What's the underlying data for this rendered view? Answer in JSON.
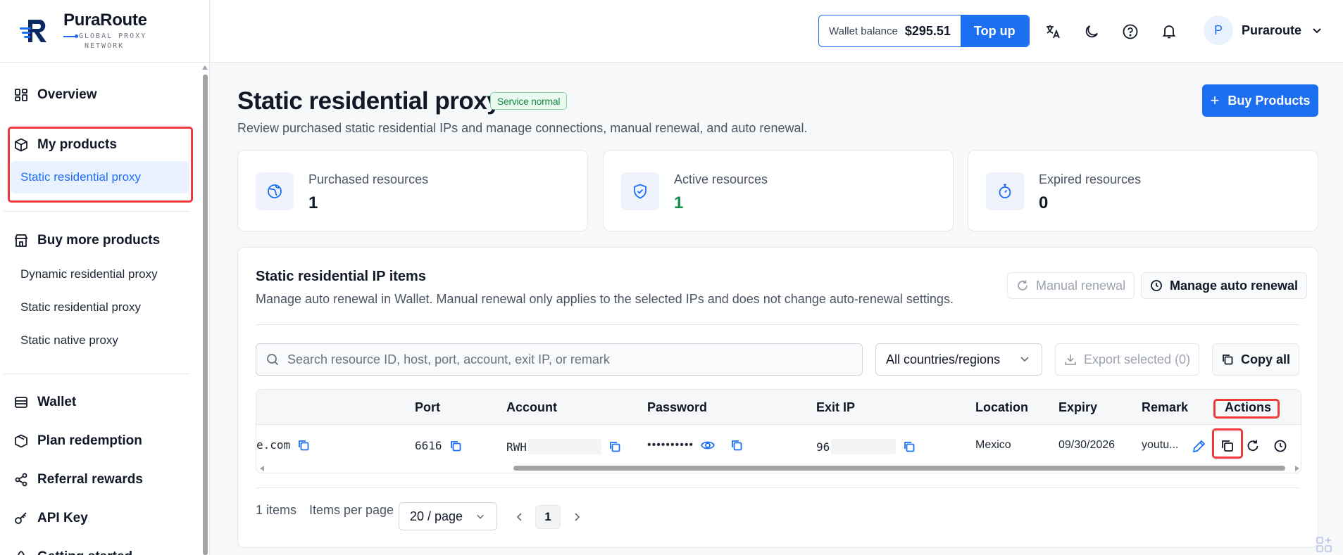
{
  "brand": {
    "name": "PuraRoute",
    "tagline_1": "GLOBAL PROXY",
    "tagline_2": "NETWORK"
  },
  "sidebar": {
    "overview": "Overview",
    "my_products": "My products",
    "my_products_sub": "Static residential proxy",
    "buy_more": "Buy more products",
    "buy_more_items": [
      "Dynamic residential proxy",
      "Static residential proxy",
      "Static native proxy"
    ],
    "wallet": "Wallet",
    "plan_redemption": "Plan redemption",
    "referral": "Referral rewards",
    "api_key": "API Key",
    "getting_started": "Getting started"
  },
  "topbar": {
    "wallet_label": "Wallet balance",
    "wallet_amount": "$295.51",
    "top_up": "Top up",
    "user_initial": "P",
    "user_name": "Puraroute"
  },
  "page": {
    "title": "Static residential proxy",
    "status_badge": "Service normal",
    "subtitle": "Review purchased static residential IPs and manage connections, manual renewal, and auto renewal.",
    "buy_button": "Buy Products"
  },
  "stats": [
    {
      "label": "Purchased resources",
      "value": "1"
    },
    {
      "label": "Active resources",
      "value": "1"
    },
    {
      "label": "Expired resources",
      "value": "0"
    }
  ],
  "panel": {
    "title": "Static residential IP items",
    "desc": "Manage auto renewal in Wallet. Manual renewal only applies to the selected IPs and does not change auto-renewal settings.",
    "manual_renewal": "Manual renewal",
    "manage_auto": "Manage auto renewal",
    "search_placeholder": "Search resource ID, host, port, account, exit IP, or remark",
    "region_select": "All countries/regions",
    "export": "Export selected (0)",
    "copy_all": "Copy all"
  },
  "table": {
    "columns": [
      "Port",
      "Account",
      "Password",
      "Exit IP",
      "Location",
      "Expiry",
      "Remark",
      "Actions"
    ],
    "row": {
      "host": "e.com",
      "port": "6616",
      "account": "RWH",
      "password": "••••••••••",
      "exit_ip": "96",
      "location": "Mexico",
      "expiry": "09/30/2026",
      "remark": "youtu..."
    }
  },
  "pagination": {
    "total": "1 items",
    "per_page_label": "Items per page",
    "per_page": "20 / page",
    "current": "1"
  },
  "colors": {
    "primary": "#1d6ff2",
    "success": "#168a46",
    "highlight": "#ef3a3a"
  }
}
